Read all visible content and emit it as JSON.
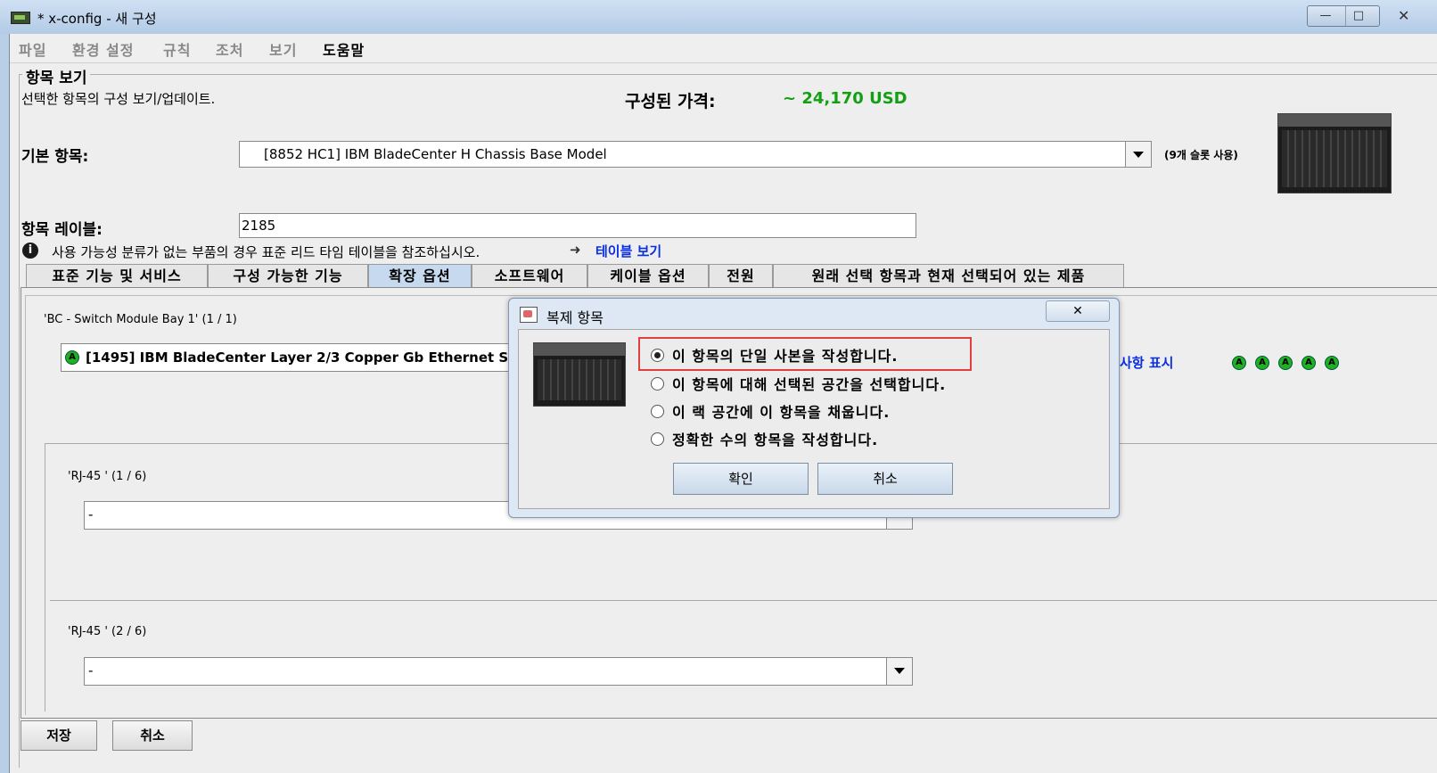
{
  "window": {
    "title": "* x-config - 새 구성",
    "minimize": "—",
    "maximize": "□",
    "close": "✕"
  },
  "menu": [
    "파일",
    "환경 설정",
    "규칙",
    "조처",
    "보기",
    "도움말"
  ],
  "section": {
    "legend": "항목 보기",
    "description": "선택한 항목의 구성 보기/업데이트.",
    "price_label": "구성된 가격:",
    "price_value": "~ 24,170 USD"
  },
  "base_item": {
    "label": "기본 항목:",
    "value": "[8852 HC1] IBM BladeCenter H Chassis Base Model",
    "slots_note": "(9개 슬롯 사용)"
  },
  "item_label": {
    "label": "항목 레이블:",
    "value": "2185"
  },
  "info": {
    "icon": "info-icon",
    "text": "사용 가능성 분류가 없는 부품의 경우 표준 리드 타임 테이블을 참조하십시오.",
    "arrow": "➜",
    "link": "테이블 보기"
  },
  "tabs": [
    "표준 기능 및 서비스",
    "구성 가능한 기능",
    "확장 옵션",
    "소프트웨어",
    "케이블 옵션",
    "전원",
    "원래 선택 항목과 현재 선택되어 있는 제품"
  ],
  "active_tab": "확장 옵션",
  "bay": {
    "title": "'BC - Switch Module Bay 1' (1 / 1)",
    "selected": "[1495] IBM BladeCenter Layer 2/3 Copper Gb Ethernet S",
    "show_link": "사항 표시",
    "status_icons": [
      "A",
      "A",
      "A",
      "A",
      "A"
    ]
  },
  "rj45": [
    {
      "title": "'RJ-45 ' (1 / 6)",
      "value": "-"
    },
    {
      "title": "'RJ-45 ' (2 / 6)",
      "value": "-"
    }
  ],
  "footer": {
    "save": "저장",
    "cancel": "취소"
  },
  "dialog": {
    "title": "복제 항목",
    "close": "✕",
    "options": [
      "이 항목의 단일 사본을 작성합니다.",
      "이 항목에 대해 선택된 공간을 선택합니다.",
      "이 랙 공간에 이 항목을 채웁니다.",
      "정확한 수의 항목을 작성합니다."
    ],
    "selected_index": 0,
    "ok": "확인",
    "cancel": "취소"
  }
}
